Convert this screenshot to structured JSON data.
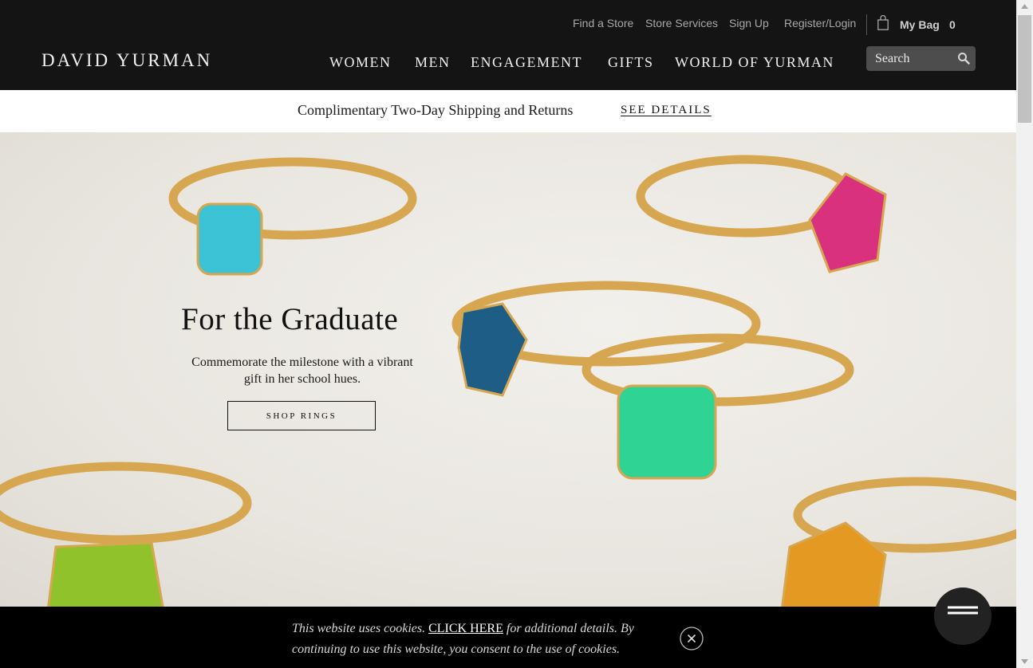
{
  "header": {
    "utility_links": [
      "Find a Store",
      "Store Services",
      "Sign Up",
      "Register/Login"
    ],
    "bag_label": "My Bag",
    "bag_count": "0",
    "logo_text": "DAVID YURMAN",
    "nav": [
      "WOMEN",
      "MEN",
      "ENGAGEMENT",
      "GIFTS",
      "WORLD OF YURMAN"
    ],
    "search_placeholder": "Search"
  },
  "promo": {
    "text": "Complimentary Two-Day Shipping and Returns",
    "link": "SEE DETAILS"
  },
  "hero": {
    "title": "For the Graduate",
    "subtitle": "Commemorate the milestone with a vibrant gift in her school hues.",
    "button": "SHOP RINGS",
    "gem_colors": [
      "#3cc3d6",
      "#d9317e",
      "#1d5d86",
      "#2fd394",
      "#8fc22b",
      "#e49a22"
    ],
    "metal_color": "#d7a650"
  },
  "cookie": {
    "text_before": "This website uses cookies. ",
    "link": "CLICK HERE",
    "text_after": " for additional details. By continuing to use this website, you consent to the use of cookies."
  },
  "colors": {
    "header_bg": "#141414",
    "cookie_bg": "#000000"
  }
}
